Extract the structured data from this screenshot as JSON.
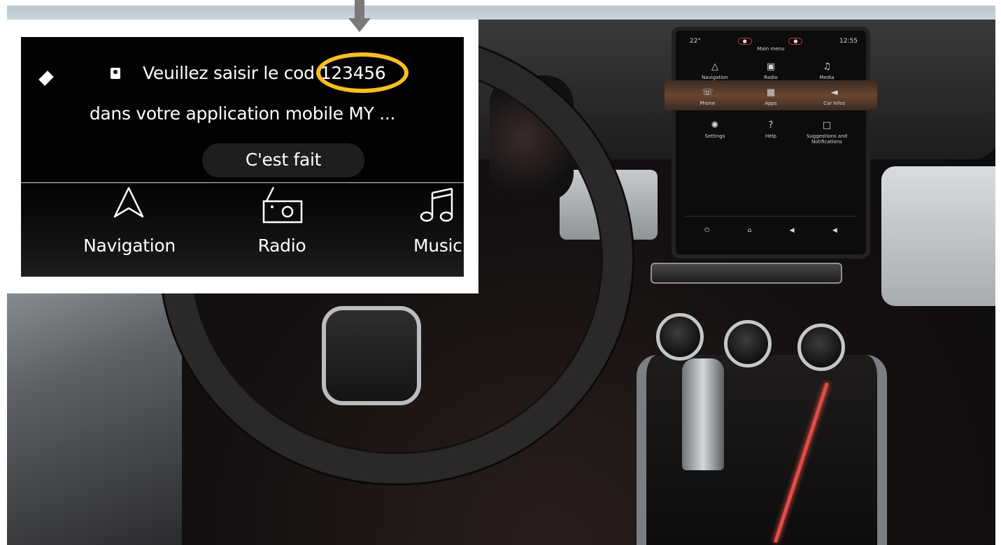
{
  "notification": {
    "line1_prefix": "Veuillez saisir le cod",
    "code": "123456",
    "line2": "dans votre application mobile MY ...",
    "confirm_button": "C'est fait",
    "icons": [
      "renault-logo-icon",
      "contact-card-icon"
    ]
  },
  "inset_menu": {
    "items": [
      {
        "label": "Navigation",
        "icon": "navigation-arrow-icon"
      },
      {
        "label": "Radio",
        "icon": "radio-icon"
      },
      {
        "label": "Music",
        "icon": "music-note-icon"
      }
    ]
  },
  "car_screen": {
    "temperature": "22°",
    "time": "12:55",
    "title": "Main menu",
    "items": [
      {
        "label": "Navigation"
      },
      {
        "label": "Radio"
      },
      {
        "label": "Media"
      },
      {
        "label": "Phone"
      },
      {
        "label": "Apps"
      },
      {
        "label": "Car Infos"
      },
      {
        "label": "Settings"
      },
      {
        "label": "Help"
      },
      {
        "label": "Suggestions and Notifications"
      }
    ]
  },
  "colors": {
    "highlight": "#f7bf22",
    "arrow": "#7a7a7a",
    "screen_bg": "#000000",
    "button_bg": "#1e1e1e"
  }
}
